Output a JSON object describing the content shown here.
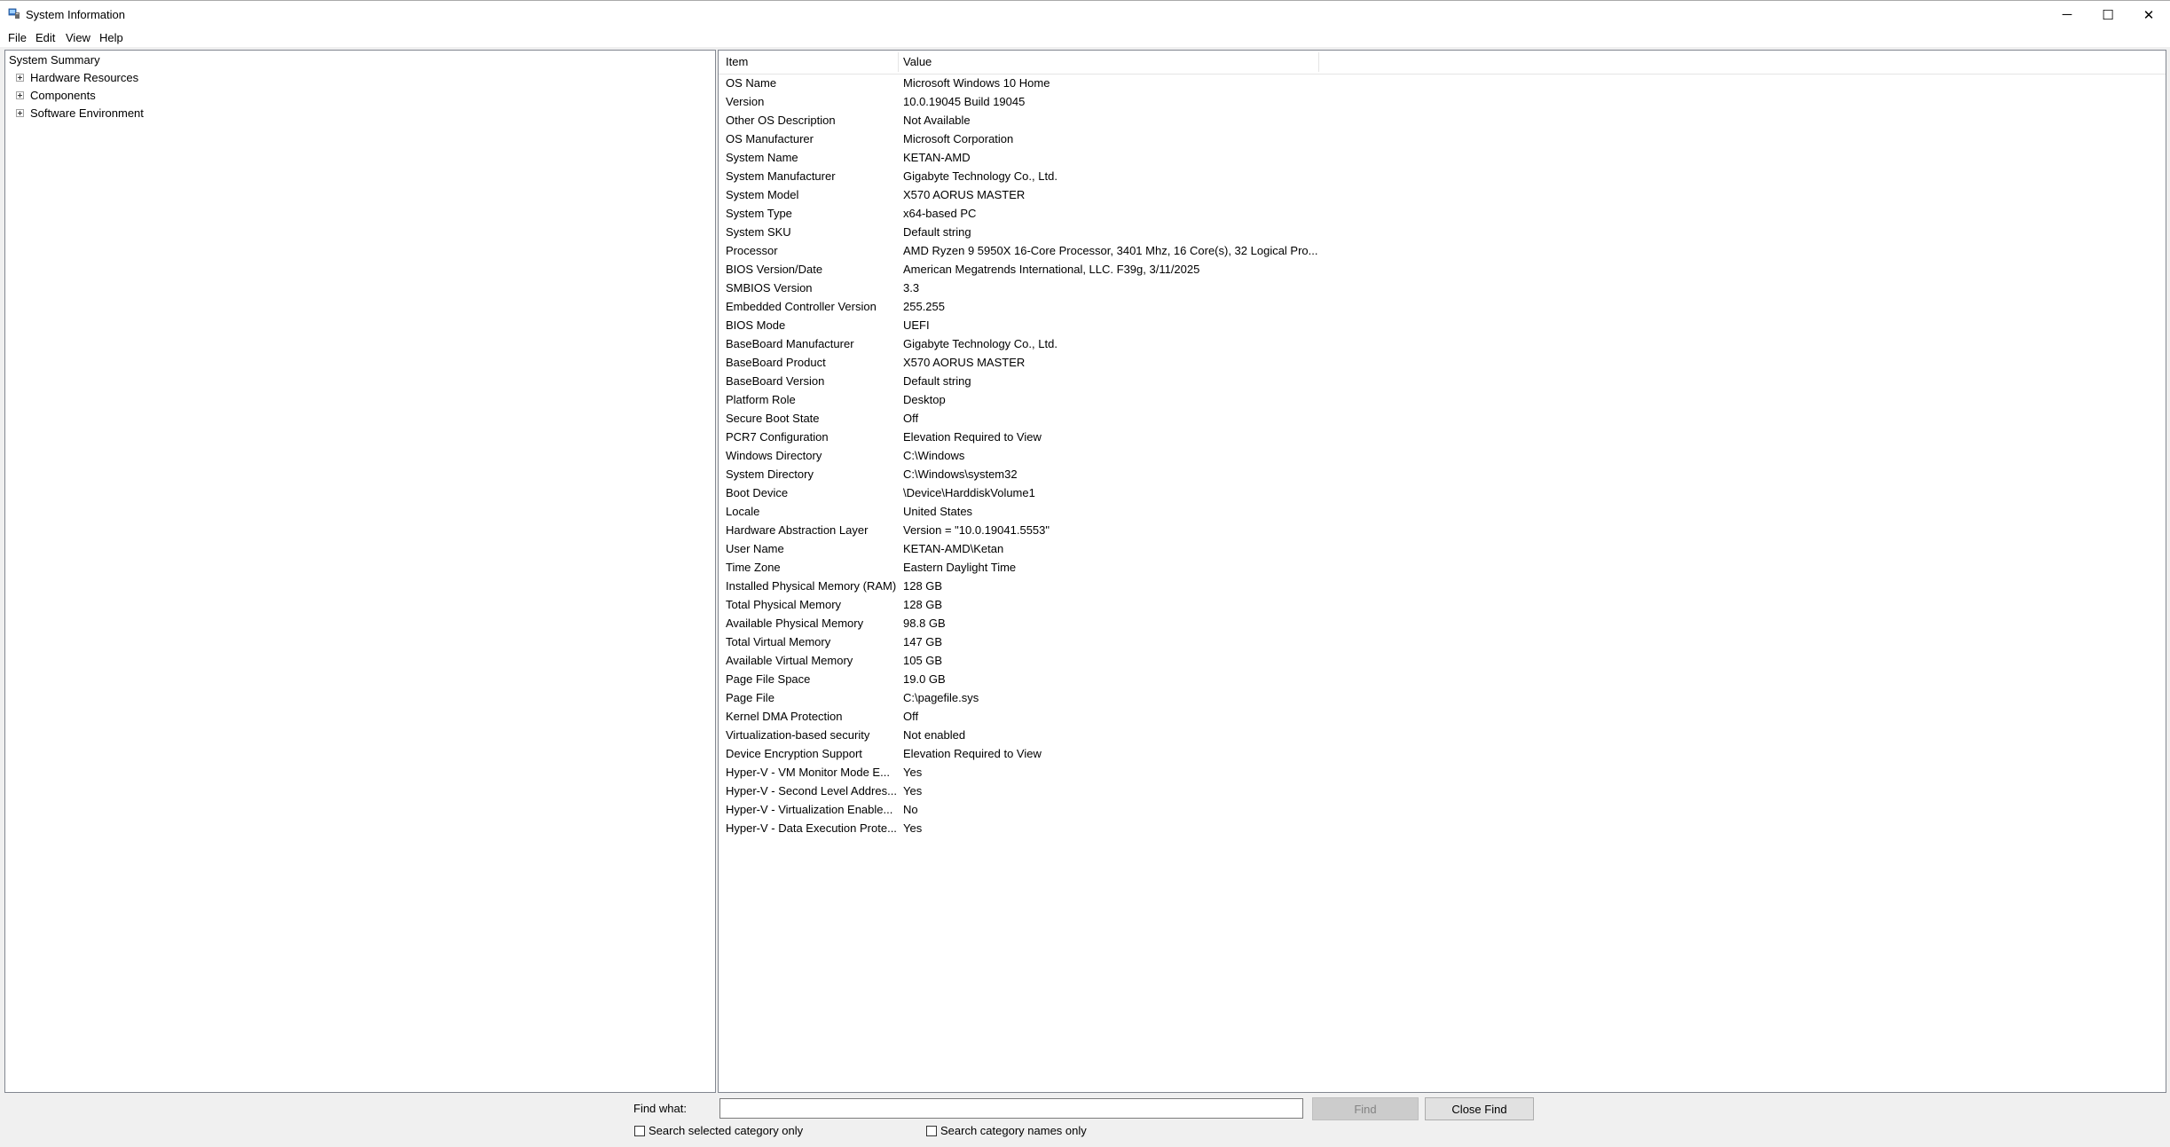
{
  "window": {
    "title": "System Information",
    "icon": "system-information-icon",
    "controls": {
      "minimize": "─",
      "maximize": "☐",
      "close": "✕"
    }
  },
  "menu": [
    "File",
    "Edit",
    "View",
    "Help"
  ],
  "tree": {
    "root": "System Summary",
    "children": [
      "Hardware Resources",
      "Components",
      "Software Environment"
    ]
  },
  "list": {
    "headers": {
      "item": "Item",
      "value": "Value"
    },
    "rows": [
      {
        "item": "OS Name",
        "value": "Microsoft Windows 10 Home"
      },
      {
        "item": "Version",
        "value": "10.0.19045 Build 19045"
      },
      {
        "item": "Other OS Description",
        "value": "Not Available"
      },
      {
        "item": "OS Manufacturer",
        "value": "Microsoft Corporation"
      },
      {
        "item": "System Name",
        "value": "KETAN-AMD"
      },
      {
        "item": "System Manufacturer",
        "value": "Gigabyte Technology Co., Ltd."
      },
      {
        "item": "System Model",
        "value": "X570 AORUS MASTER"
      },
      {
        "item": "System Type",
        "value": "x64-based PC"
      },
      {
        "item": "System SKU",
        "value": "Default string"
      },
      {
        "item": "Processor",
        "value": "AMD Ryzen 9 5950X 16-Core Processor, 3401 Mhz, 16 Core(s), 32 Logical Pro..."
      },
      {
        "item": "BIOS Version/Date",
        "value": "American Megatrends International, LLC. F39g, 3/11/2025"
      },
      {
        "item": "SMBIOS Version",
        "value": "3.3"
      },
      {
        "item": "Embedded Controller Version",
        "value": "255.255"
      },
      {
        "item": "BIOS Mode",
        "value": "UEFI"
      },
      {
        "item": "BaseBoard Manufacturer",
        "value": "Gigabyte Technology Co., Ltd."
      },
      {
        "item": "BaseBoard Product",
        "value": "X570 AORUS MASTER"
      },
      {
        "item": "BaseBoard Version",
        "value": "Default string"
      },
      {
        "item": "Platform Role",
        "value": "Desktop"
      },
      {
        "item": "Secure Boot State",
        "value": "Off"
      },
      {
        "item": "PCR7 Configuration",
        "value": "Elevation Required to View"
      },
      {
        "item": "Windows Directory",
        "value": "C:\\Windows"
      },
      {
        "item": "System Directory",
        "value": "C:\\Windows\\system32"
      },
      {
        "item": "Boot Device",
        "value": "\\Device\\HarddiskVolume1"
      },
      {
        "item": "Locale",
        "value": "United States"
      },
      {
        "item": "Hardware Abstraction Layer",
        "value": "Version = \"10.0.19041.5553\""
      },
      {
        "item": "User Name",
        "value": "KETAN-AMD\\Ketan"
      },
      {
        "item": "Time Zone",
        "value": "Eastern Daylight Time"
      },
      {
        "item": "Installed Physical Memory (RAM)",
        "value": "128 GB"
      },
      {
        "item": "Total Physical Memory",
        "value": "128 GB"
      },
      {
        "item": "Available Physical Memory",
        "value": "98.8 GB"
      },
      {
        "item": "Total Virtual Memory",
        "value": "147 GB"
      },
      {
        "item": "Available Virtual Memory",
        "value": "105 GB"
      },
      {
        "item": "Page File Space",
        "value": "19.0 GB"
      },
      {
        "item": "Page File",
        "value": "C:\\pagefile.sys"
      },
      {
        "item": "Kernel DMA Protection",
        "value": "Off"
      },
      {
        "item": "Virtualization-based security",
        "value": "Not enabled"
      },
      {
        "item": "Device Encryption Support",
        "value": "Elevation Required to View"
      },
      {
        "item": "Hyper-V - VM Monitor Mode E...",
        "value": "Yes"
      },
      {
        "item": "Hyper-V - Second Level Addres...",
        "value": "Yes"
      },
      {
        "item": "Hyper-V - Virtualization Enable...",
        "value": "No"
      },
      {
        "item": "Hyper-V - Data Execution Prote...",
        "value": "Yes"
      }
    ]
  },
  "find": {
    "label": "Find what:",
    "value": "",
    "placeholder": "",
    "find_button": "Find",
    "close_button": "Close Find",
    "search_selected": "Search selected category only",
    "search_names": "Search category names only"
  }
}
